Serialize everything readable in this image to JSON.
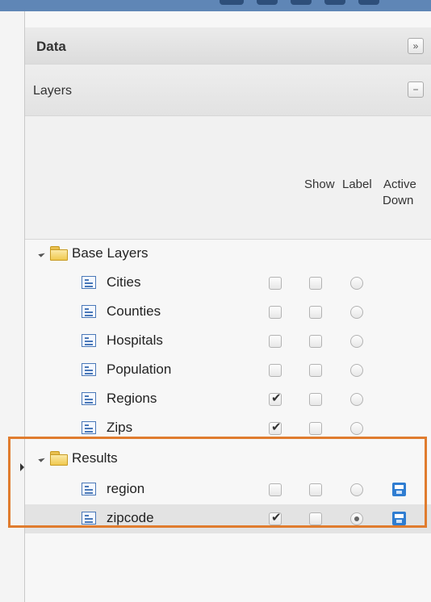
{
  "panel": {
    "title": "Data",
    "collapse_glyph": "»",
    "section_title": "Layers",
    "section_toggle_glyph": "−"
  },
  "columns": {
    "show": "Show",
    "label": "Label",
    "active_line1": "Active",
    "active_line2": "Down"
  },
  "groups": [
    {
      "label": "Base Layers",
      "layers": [
        {
          "label": "Cities",
          "show": false,
          "label_on": false,
          "active": false
        },
        {
          "label": "Counties",
          "show": false,
          "label_on": false,
          "active": false
        },
        {
          "label": "Hospitals",
          "show": false,
          "label_on": false,
          "active": false
        },
        {
          "label": "Population",
          "show": false,
          "label_on": false,
          "active": false
        },
        {
          "label": "Regions",
          "show": true,
          "label_on": false,
          "active": false
        },
        {
          "label": "Zips",
          "show": true,
          "label_on": false,
          "active": false
        }
      ]
    },
    {
      "label": "Results",
      "layers": [
        {
          "label": "region",
          "show": false,
          "label_on": false,
          "active": false,
          "save_icon": "save-icon"
        },
        {
          "label": "zipcode",
          "show": true,
          "label_on": false,
          "active": true,
          "save_icon": "save-icon",
          "selected": true
        }
      ]
    }
  ],
  "icons": {
    "expander": "expand-triangle-icon",
    "folder": "folder-icon",
    "layer": "layer-list-icon",
    "save": "save-icon"
  },
  "colors": {
    "highlight_border": "#e07c2e",
    "save_icon": "#2f7dd1",
    "layer_icon": "#4a78b8",
    "selected_row": "#e3e3e3"
  }
}
